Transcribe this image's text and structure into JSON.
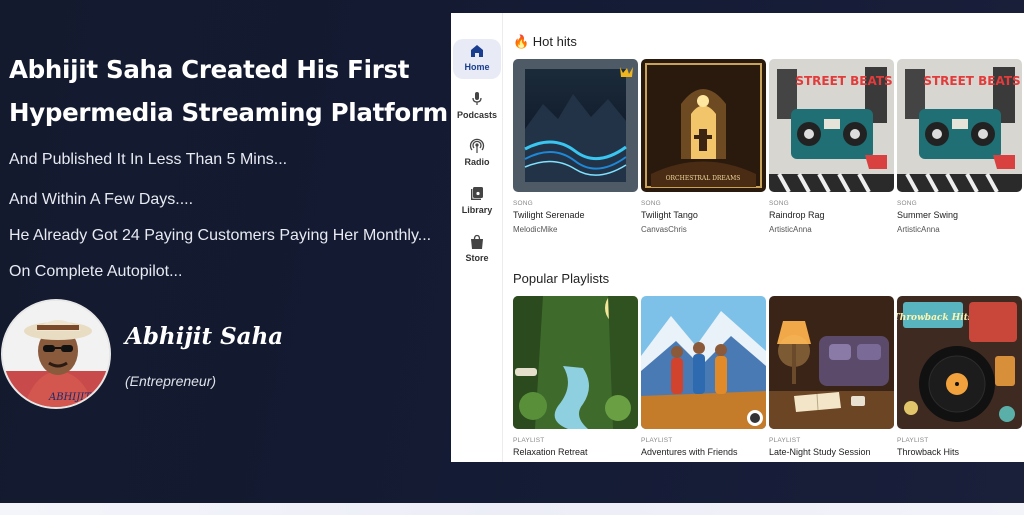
{
  "hero": {
    "headline_line1": "Abhijit Saha Created His First",
    "headline_line2": "Hypermedia Streaming Platform",
    "subtitles": [
      "And Published It In Less Than 5 Mins...",
      "And Within A Few Days....",
      "He Already Got 24 Paying Customers Paying Her Monthly...",
      "On Complete Autopilot..."
    ],
    "author_name": "Abhijit Saha",
    "author_role": "(Entrepreneur)",
    "avatar_caption": "ABHIJIT"
  },
  "app": {
    "nav": [
      {
        "label": "Home",
        "icon": "home-icon",
        "active": true
      },
      {
        "label": "Podcasts",
        "icon": "microphone-icon"
      },
      {
        "label": "Radio",
        "icon": "radio-icon"
      },
      {
        "label": "Library",
        "icon": "library-icon"
      },
      {
        "label": "Store",
        "icon": "store-icon"
      }
    ],
    "hot_hits": {
      "title": "🔥 Hot hits",
      "items": [
        {
          "type": "SONG",
          "title": "Twilight Serenade",
          "artist": "MelodicMike"
        },
        {
          "type": "SONG",
          "title": "Twilight Tango",
          "artist": "CanvasChris",
          "art_text": "ORCHESTRAL DREAMS"
        },
        {
          "type": "SONG",
          "title": "Raindrop Rag",
          "artist": "ArtisticAnna",
          "art_text": "STREET BEATS"
        },
        {
          "type": "SONG",
          "title": "Summer Swing",
          "artist": "ArtisticAnna",
          "art_text": "STREET BEATS"
        }
      ]
    },
    "playlists": {
      "title": "Popular Playlists",
      "items": [
        {
          "type": "PLAYLIST",
          "title": "Relaxation Retreat"
        },
        {
          "type": "PLAYLIST",
          "title": "Adventures with Friends"
        },
        {
          "type": "PLAYLIST",
          "title": "Late-Night Study Session"
        },
        {
          "type": "PLAYLIST",
          "title": "Throwback Hits",
          "art_text": "Throwback Hits"
        }
      ]
    }
  }
}
